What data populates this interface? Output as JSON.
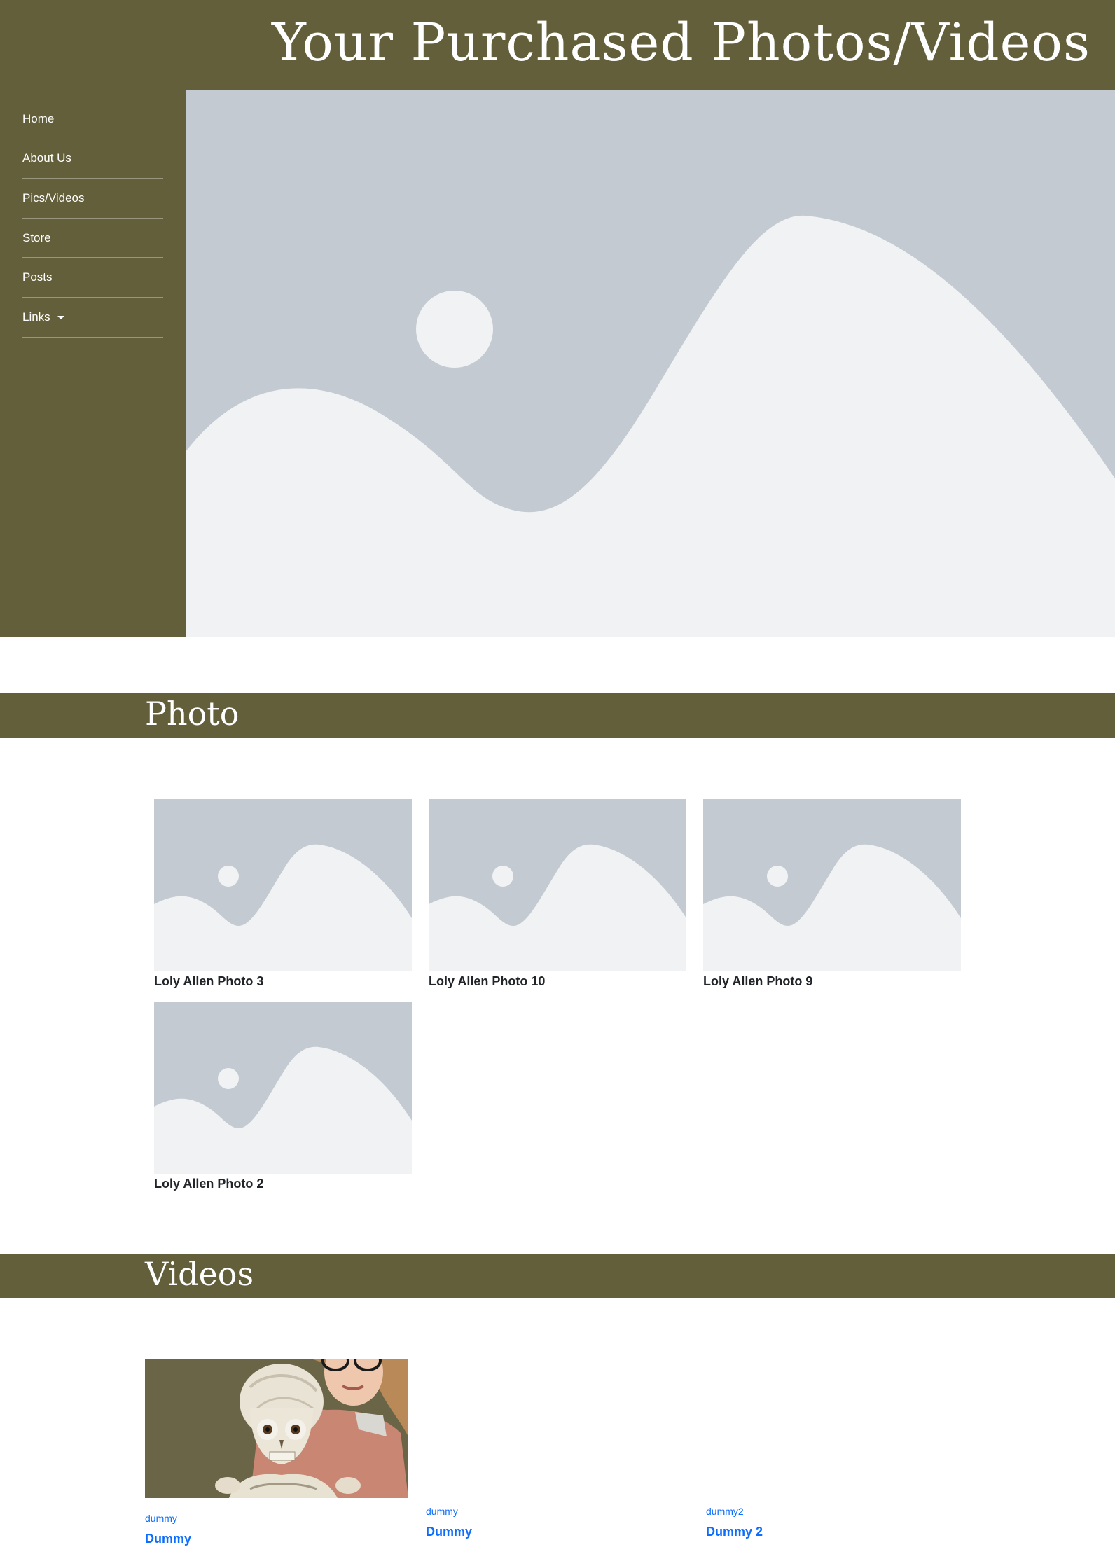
{
  "header": {
    "title": "Your Purchased Photos/Videos"
  },
  "sidebar": {
    "items": [
      {
        "label": "Home"
      },
      {
        "label": "About Us"
      },
      {
        "label": "Pics/Videos"
      },
      {
        "label": "Store"
      },
      {
        "label": "Posts"
      },
      {
        "label": "Links",
        "has_dropdown": true
      }
    ]
  },
  "hero": {
    "icon": "image-placeholder-icon"
  },
  "photo_section": {
    "title": "Photo",
    "photos": [
      {
        "caption": "Loly Allen Photo 3"
      },
      {
        "caption": "Loly Allen Photo 10"
      },
      {
        "caption": "Loly Allen Photo 9"
      },
      {
        "caption": "Loly Allen Photo 2"
      }
    ]
  },
  "video_section": {
    "title": "Videos",
    "videos": [
      {
        "category": "dummy",
        "title": "Dummy"
      },
      {
        "category": "dummy",
        "title": "Dummy"
      },
      {
        "category": "dummy2",
        "title": "Dummy 2"
      }
    ]
  },
  "colors": {
    "brand": "#635f3a",
    "placeholder_bg": "#c3cad1",
    "placeholder_fg": "#f1f2f4",
    "link": "#0d6efd"
  }
}
